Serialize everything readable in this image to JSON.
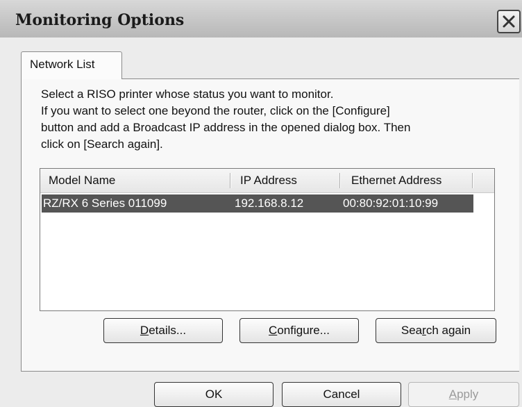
{
  "window": {
    "title": "Monitoring Options",
    "close_icon": "close-icon"
  },
  "tabs": [
    {
      "label": "Network List",
      "active": true
    }
  ],
  "instructions": {
    "line1": "Select a RISO printer whose status you want to monitor.",
    "line2": "If you want to select one beyond the router, click on the [Configure]",
    "line3": "button and add a Broadcast IP address in the opened dialog box. Then",
    "line4": "click on [Search again]."
  },
  "printer_list": {
    "columns": [
      "Model Name",
      "IP Address",
      "Ethernet Address"
    ],
    "rows": [
      {
        "model": "RZ/RX 6 Series 011099",
        "ip": "192.168.8.12",
        "mac": "00:80:92:01:10:99",
        "selected": true
      }
    ]
  },
  "panel_buttons": {
    "details": {
      "before": "",
      "mnemonic": "D",
      "after": "etails..."
    },
    "configure": {
      "before": "",
      "mnemonic": "C",
      "after": "onfigure..."
    },
    "search_again": {
      "before": "Sea",
      "mnemonic": "r",
      "after": "ch again"
    }
  },
  "dialog_buttons": {
    "ok": "OK",
    "cancel": "Cancel",
    "apply": {
      "before": "",
      "mnemonic": "A",
      "after": "pply",
      "enabled": false
    }
  }
}
